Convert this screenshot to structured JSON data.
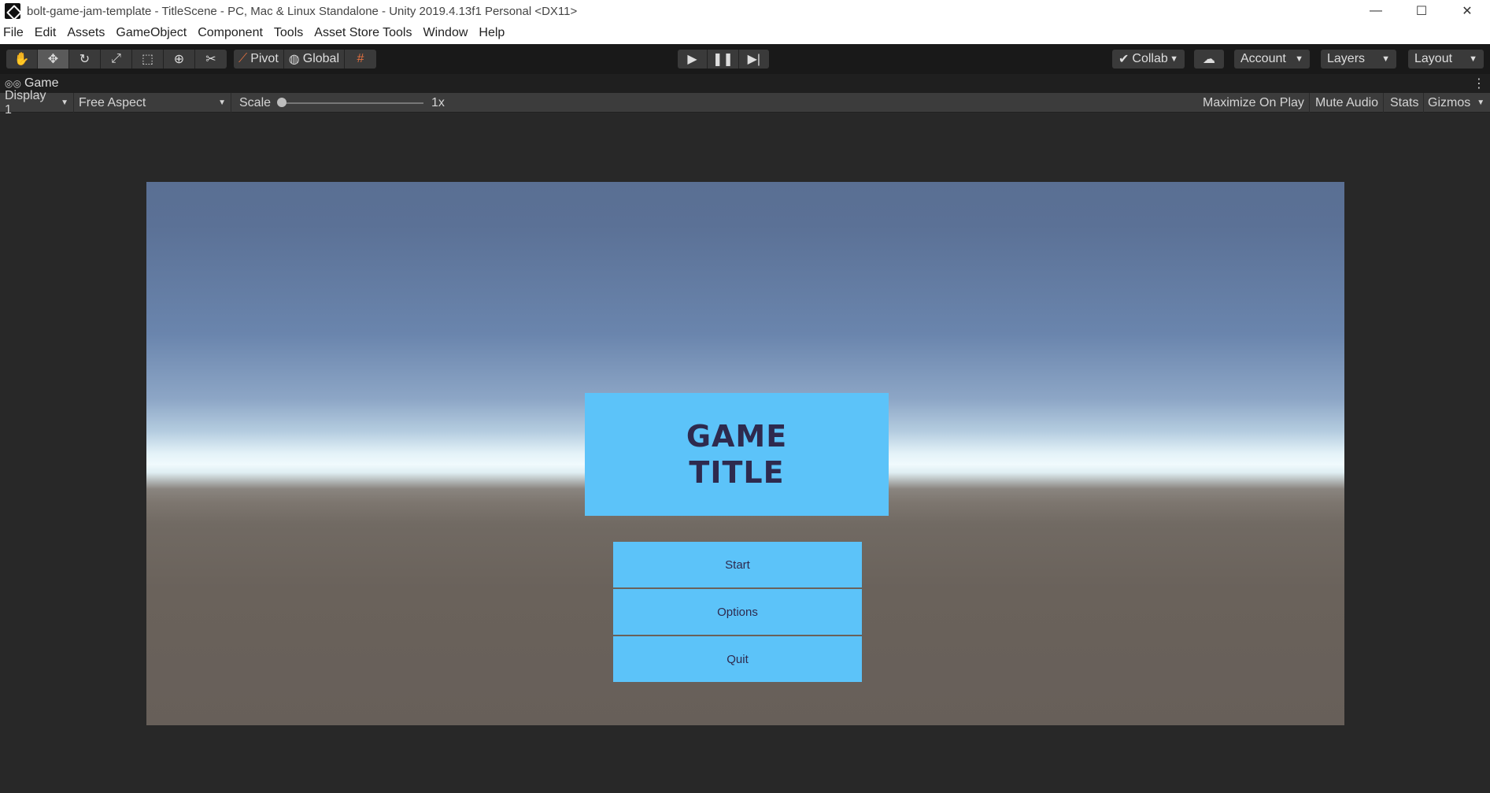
{
  "window": {
    "title": "bolt-game-jam-template - TitleScene - PC, Mac & Linux Standalone - Unity 2019.4.13f1 Personal <DX11>",
    "controls": [
      "—",
      "☐",
      "✕"
    ]
  },
  "menu": [
    "File",
    "Edit",
    "Assets",
    "GameObject",
    "Component",
    "Tools",
    "Asset Store Tools",
    "Window",
    "Help"
  ],
  "toolbar": {
    "tools": [
      "hand-icon",
      "move-icon",
      "rotate-icon",
      "scale-icon",
      "rect-icon",
      "transform-icon",
      "custom-tool-icon"
    ],
    "pivot_label": "Pivot",
    "global_label": "Global",
    "collab_label": "Collab",
    "account_label": "Account",
    "layers_label": "Layers",
    "layout_label": "Layout"
  },
  "tab": {
    "label": "Game"
  },
  "gamebar": {
    "display": "Display 1",
    "aspect": "Free Aspect",
    "scale_label": "Scale",
    "scale_value": "1x",
    "scale_level": 0,
    "maximize": "Maximize On Play",
    "mute": "Mute Audio",
    "stats": "Stats",
    "gizmos": "Gizmos"
  },
  "game": {
    "title_line1": "GAME",
    "title_line2": "TITLE",
    "buttons": [
      "Start",
      "Options",
      "Quit"
    ],
    "accent_color": "#5cc3f9",
    "text_color": "#2e2a4e"
  }
}
